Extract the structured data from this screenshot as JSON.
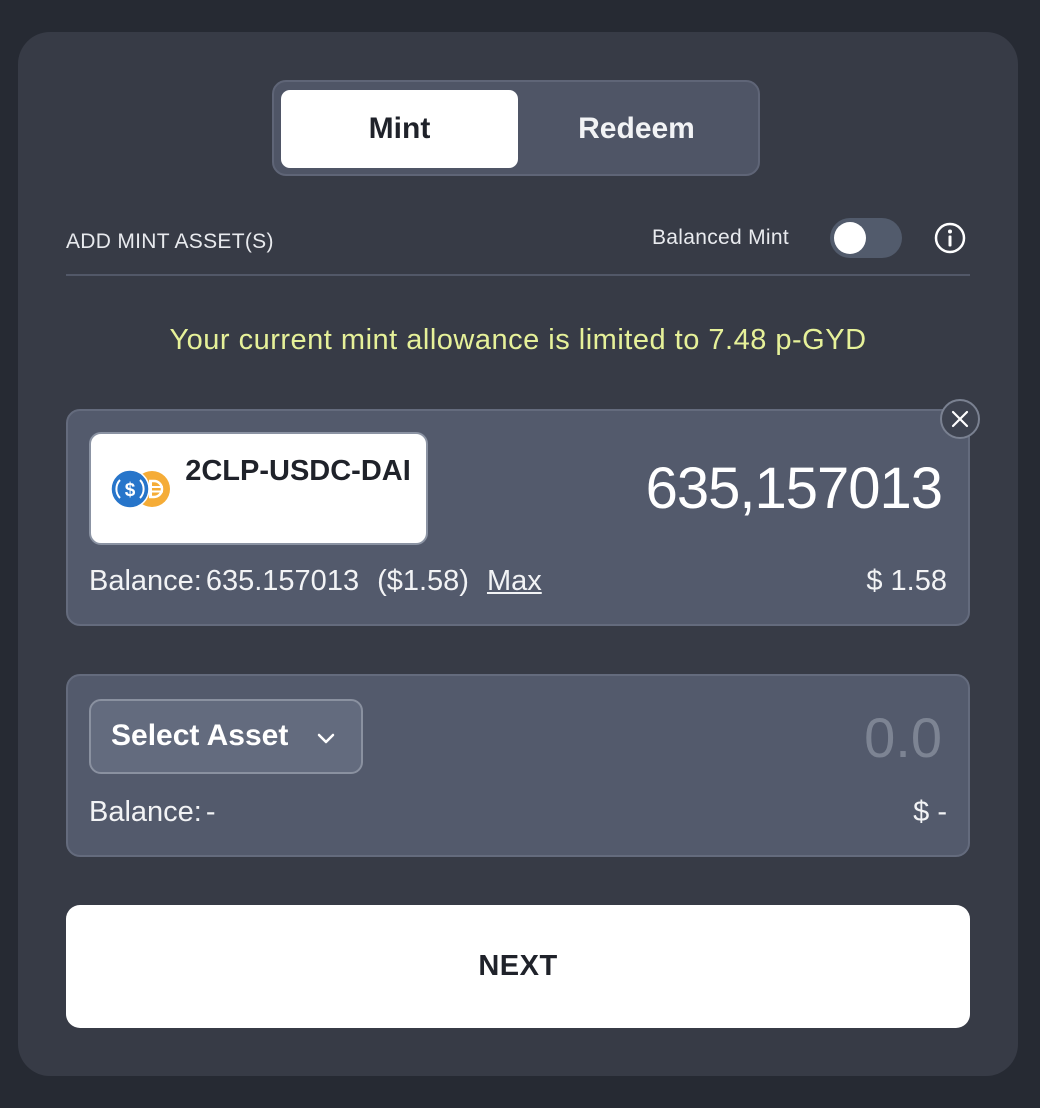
{
  "tabs": {
    "mint_label": "Mint",
    "redeem_label": "Redeem",
    "active": "Mint"
  },
  "header": {
    "add_assets_label": "ADD MINT ASSET(S)",
    "balanced_mint_label": "Balanced Mint",
    "balanced_mint_enabled": false,
    "info_icon": "info-icon"
  },
  "allowance_message": "Your current mint allowance is limited to 7.48 p-GYD",
  "asset_rows": [
    {
      "token_name": "2CLP-USDC-DAI",
      "token_icons": [
        "usdc-icon",
        "dai-icon"
      ],
      "amount": "635,157013",
      "balance_label": "Balance:",
      "balance_value": "635.157013",
      "balance_usd": "($1.58)",
      "max_label": "Max",
      "usd_value": "$ 1.58",
      "remove_icon": "close-icon"
    },
    {
      "select_label": "Select Asset",
      "select_icon": "chevron-down-icon",
      "amount_placeholder": "0.0",
      "balance_label": "Balance:",
      "balance_value": "-",
      "usd_value": "$ -"
    }
  ],
  "next_label": "NEXT",
  "colors": {
    "page_bg": "#262a33",
    "card_bg": "#373b46",
    "box_bg": "#535a6c",
    "allowance_text": "#e6f199",
    "usdc_blue": "#2775ca",
    "dai_yellow": "#f5ac37"
  }
}
